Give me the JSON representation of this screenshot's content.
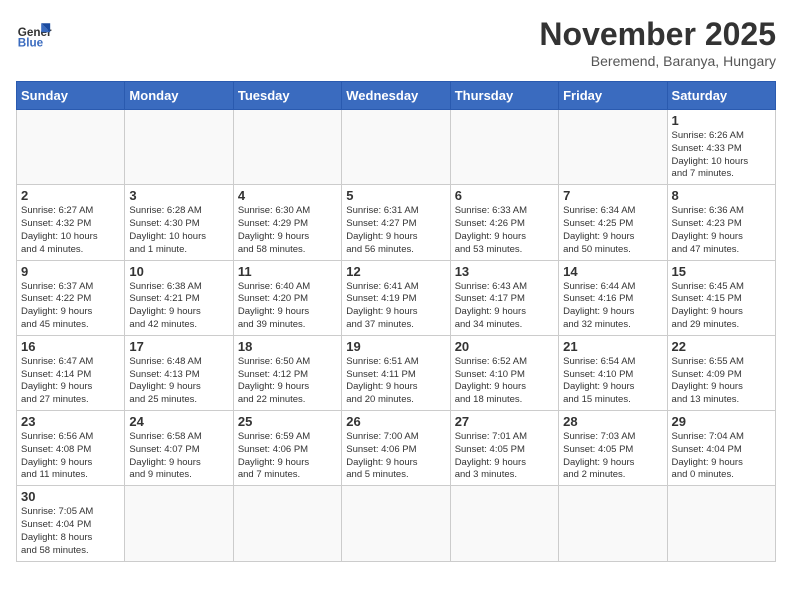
{
  "logo": {
    "text_general": "General",
    "text_blue": "Blue"
  },
  "title": "November 2025",
  "subtitle": "Beremend, Baranya, Hungary",
  "days_of_week": [
    "Sunday",
    "Monday",
    "Tuesday",
    "Wednesday",
    "Thursday",
    "Friday",
    "Saturday"
  ],
  "weeks": [
    [
      {
        "day": "",
        "info": ""
      },
      {
        "day": "",
        "info": ""
      },
      {
        "day": "",
        "info": ""
      },
      {
        "day": "",
        "info": ""
      },
      {
        "day": "",
        "info": ""
      },
      {
        "day": "",
        "info": ""
      },
      {
        "day": "1",
        "info": "Sunrise: 6:26 AM\nSunset: 4:33 PM\nDaylight: 10 hours\nand 7 minutes."
      }
    ],
    [
      {
        "day": "2",
        "info": "Sunrise: 6:27 AM\nSunset: 4:32 PM\nDaylight: 10 hours\nand 4 minutes."
      },
      {
        "day": "3",
        "info": "Sunrise: 6:28 AM\nSunset: 4:30 PM\nDaylight: 10 hours\nand 1 minute."
      },
      {
        "day": "4",
        "info": "Sunrise: 6:30 AM\nSunset: 4:29 PM\nDaylight: 9 hours\nand 58 minutes."
      },
      {
        "day": "5",
        "info": "Sunrise: 6:31 AM\nSunset: 4:27 PM\nDaylight: 9 hours\nand 56 minutes."
      },
      {
        "day": "6",
        "info": "Sunrise: 6:33 AM\nSunset: 4:26 PM\nDaylight: 9 hours\nand 53 minutes."
      },
      {
        "day": "7",
        "info": "Sunrise: 6:34 AM\nSunset: 4:25 PM\nDaylight: 9 hours\nand 50 minutes."
      },
      {
        "day": "8",
        "info": "Sunrise: 6:36 AM\nSunset: 4:23 PM\nDaylight: 9 hours\nand 47 minutes."
      }
    ],
    [
      {
        "day": "9",
        "info": "Sunrise: 6:37 AM\nSunset: 4:22 PM\nDaylight: 9 hours\nand 45 minutes."
      },
      {
        "day": "10",
        "info": "Sunrise: 6:38 AM\nSunset: 4:21 PM\nDaylight: 9 hours\nand 42 minutes."
      },
      {
        "day": "11",
        "info": "Sunrise: 6:40 AM\nSunset: 4:20 PM\nDaylight: 9 hours\nand 39 minutes."
      },
      {
        "day": "12",
        "info": "Sunrise: 6:41 AM\nSunset: 4:19 PM\nDaylight: 9 hours\nand 37 minutes."
      },
      {
        "day": "13",
        "info": "Sunrise: 6:43 AM\nSunset: 4:17 PM\nDaylight: 9 hours\nand 34 minutes."
      },
      {
        "day": "14",
        "info": "Sunrise: 6:44 AM\nSunset: 4:16 PM\nDaylight: 9 hours\nand 32 minutes."
      },
      {
        "day": "15",
        "info": "Sunrise: 6:45 AM\nSunset: 4:15 PM\nDaylight: 9 hours\nand 29 minutes."
      }
    ],
    [
      {
        "day": "16",
        "info": "Sunrise: 6:47 AM\nSunset: 4:14 PM\nDaylight: 9 hours\nand 27 minutes."
      },
      {
        "day": "17",
        "info": "Sunrise: 6:48 AM\nSunset: 4:13 PM\nDaylight: 9 hours\nand 25 minutes."
      },
      {
        "day": "18",
        "info": "Sunrise: 6:50 AM\nSunset: 4:12 PM\nDaylight: 9 hours\nand 22 minutes."
      },
      {
        "day": "19",
        "info": "Sunrise: 6:51 AM\nSunset: 4:11 PM\nDaylight: 9 hours\nand 20 minutes."
      },
      {
        "day": "20",
        "info": "Sunrise: 6:52 AM\nSunset: 4:10 PM\nDaylight: 9 hours\nand 18 minutes."
      },
      {
        "day": "21",
        "info": "Sunrise: 6:54 AM\nSunset: 4:10 PM\nDaylight: 9 hours\nand 15 minutes."
      },
      {
        "day": "22",
        "info": "Sunrise: 6:55 AM\nSunset: 4:09 PM\nDaylight: 9 hours\nand 13 minutes."
      }
    ],
    [
      {
        "day": "23",
        "info": "Sunrise: 6:56 AM\nSunset: 4:08 PM\nDaylight: 9 hours\nand 11 minutes."
      },
      {
        "day": "24",
        "info": "Sunrise: 6:58 AM\nSunset: 4:07 PM\nDaylight: 9 hours\nand 9 minutes."
      },
      {
        "day": "25",
        "info": "Sunrise: 6:59 AM\nSunset: 4:06 PM\nDaylight: 9 hours\nand 7 minutes."
      },
      {
        "day": "26",
        "info": "Sunrise: 7:00 AM\nSunset: 4:06 PM\nDaylight: 9 hours\nand 5 minutes."
      },
      {
        "day": "27",
        "info": "Sunrise: 7:01 AM\nSunset: 4:05 PM\nDaylight: 9 hours\nand 3 minutes."
      },
      {
        "day": "28",
        "info": "Sunrise: 7:03 AM\nSunset: 4:05 PM\nDaylight: 9 hours\nand 2 minutes."
      },
      {
        "day": "29",
        "info": "Sunrise: 7:04 AM\nSunset: 4:04 PM\nDaylight: 9 hours\nand 0 minutes."
      }
    ],
    [
      {
        "day": "30",
        "info": "Sunrise: 7:05 AM\nSunset: 4:04 PM\nDaylight: 8 hours\nand 58 minutes."
      },
      {
        "day": "",
        "info": ""
      },
      {
        "day": "",
        "info": ""
      },
      {
        "day": "",
        "info": ""
      },
      {
        "day": "",
        "info": ""
      },
      {
        "day": "",
        "info": ""
      },
      {
        "day": "",
        "info": ""
      }
    ]
  ]
}
